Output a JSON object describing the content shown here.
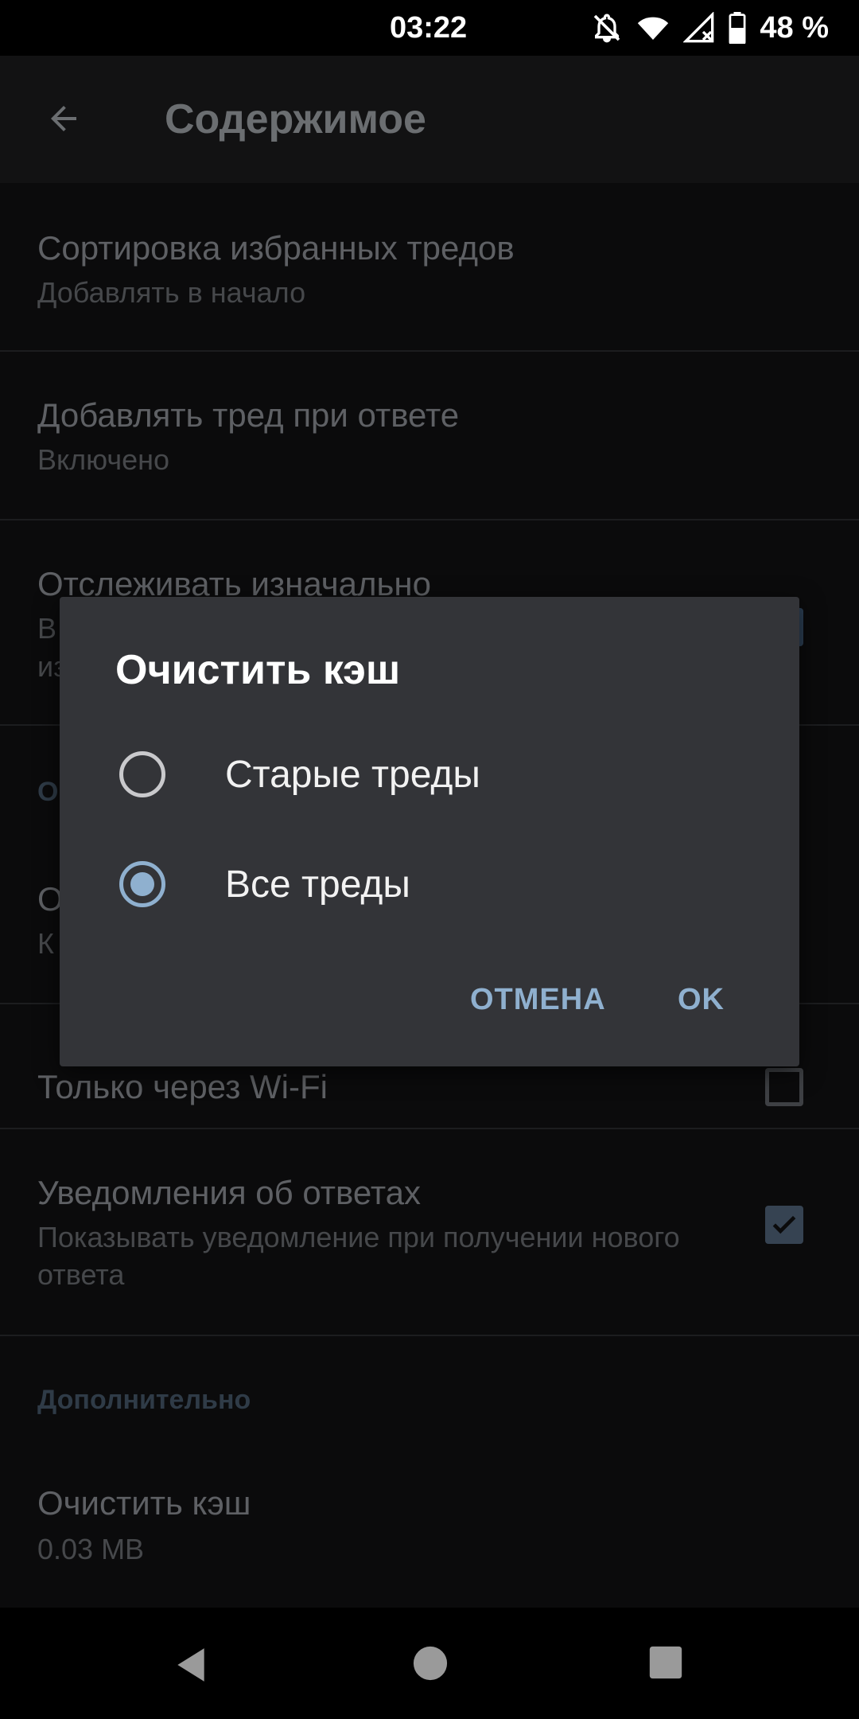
{
  "status_bar": {
    "time": "03:22",
    "battery": "48 %",
    "icons": [
      "notifications-off-icon",
      "wifi-icon",
      "no-signal-icon",
      "battery-icon"
    ]
  },
  "app_bar": {
    "title": "Содержимое",
    "back_icon": "arrow-left-icon"
  },
  "preferences": [
    {
      "title": "Сортировка избранных тредов",
      "summary": "Добавлять в начало"
    },
    {
      "title": "Добавлять тред при ответе",
      "summary": "Включено"
    },
    {
      "title": "Отслеживать изначально",
      "summary_partial": "В",
      "summary_partial_2": "из",
      "checked": true
    },
    {
      "title_partial": "О"
    },
    {
      "title_partial": "О",
      "summary_partial": "К"
    },
    {
      "title": "Только через Wi-Fi",
      "checked": false
    },
    {
      "title": "Уведомления об ответах",
      "summary": "Показывать уведомление при получении нового ответа",
      "checked": true
    }
  ],
  "section_extra": {
    "header": "Дополнительно",
    "clear_cache": {
      "title": "Очистить кэш",
      "summary": "0.03 MB"
    }
  },
  "dialog": {
    "title": "Очистить кэш",
    "options": [
      {
        "label": "Старые треды",
        "selected": false
      },
      {
        "label": "Все треды",
        "selected": true
      }
    ],
    "cancel_label": "ОТМЕНА",
    "ok_label": "OK"
  },
  "nav_bar": {
    "icons": [
      "back-triangle-icon",
      "home-circle-icon",
      "recents-square-icon"
    ]
  },
  "colors": {
    "accent": "#8fb0cf",
    "dialog_bg": "#333438",
    "background": "#0b0b0c"
  }
}
